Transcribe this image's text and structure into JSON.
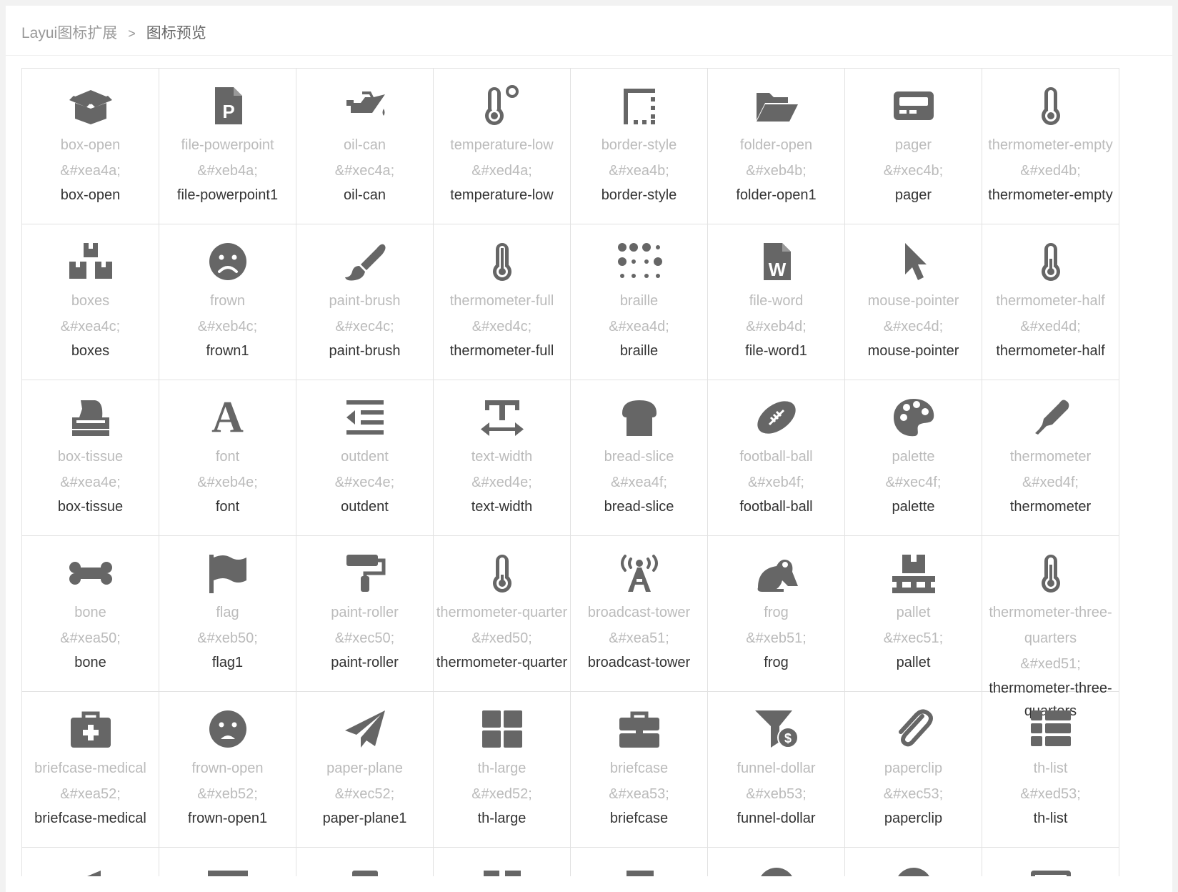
{
  "breadcrumb": {
    "home": "Layui图标扩展",
    "separator": ">",
    "current": "图标预览"
  },
  "icons": [
    {
      "icon": "box-open-icon",
      "cls": "box-open",
      "uni": "&#xea4a;",
      "name": "box-open"
    },
    {
      "icon": "file-powerpoint-icon",
      "cls": "file-powerpoint",
      "uni": "&#xeb4a;",
      "name": "file-powerpoint1"
    },
    {
      "icon": "oil-can-icon",
      "cls": "oil-can",
      "uni": "&#xec4a;",
      "name": "oil-can"
    },
    {
      "icon": "temperature-low-icon",
      "cls": "temperature-low",
      "uni": "&#xed4a;",
      "name": "temperature-low"
    },
    {
      "icon": "border-style-icon",
      "cls": "border-style",
      "uni": "&#xea4b;",
      "name": "border-style"
    },
    {
      "icon": "folder-open-icon",
      "cls": "folder-open",
      "uni": "&#xeb4b;",
      "name": "folder-open1"
    },
    {
      "icon": "pager-icon",
      "cls": "pager",
      "uni": "&#xec4b;",
      "name": "pager"
    },
    {
      "icon": "thermometer-empty-icon",
      "cls": "thermometer-empty",
      "uni": "&#xed4b;",
      "name": "thermometer-empty"
    },
    {
      "icon": "boxes-icon",
      "cls": "boxes",
      "uni": "&#xea4c;",
      "name": "boxes"
    },
    {
      "icon": "frown-icon",
      "cls": "frown",
      "uni": "&#xeb4c;",
      "name": "frown1"
    },
    {
      "icon": "paint-brush-icon",
      "cls": "paint-brush",
      "uni": "&#xec4c;",
      "name": "paint-brush"
    },
    {
      "icon": "thermometer-full-icon",
      "cls": "thermometer-full",
      "uni": "&#xed4c;",
      "name": "thermometer-full"
    },
    {
      "icon": "braille-icon",
      "cls": "braille",
      "uni": "&#xea4d;",
      "name": "braille"
    },
    {
      "icon": "file-word-icon",
      "cls": "file-word",
      "uni": "&#xeb4d;",
      "name": "file-word1"
    },
    {
      "icon": "mouse-pointer-icon",
      "cls": "mouse-pointer",
      "uni": "&#xec4d;",
      "name": "mouse-pointer"
    },
    {
      "icon": "thermometer-half-icon",
      "cls": "thermometer-half",
      "uni": "&#xed4d;",
      "name": "thermometer-half"
    },
    {
      "icon": "box-tissue-icon",
      "cls": "box-tissue",
      "uni": "&#xea4e;",
      "name": "box-tissue"
    },
    {
      "icon": "font-icon",
      "cls": "font",
      "uni": "&#xeb4e;",
      "name": "font",
      "glyph": "A"
    },
    {
      "icon": "outdent-icon",
      "cls": "outdent",
      "uni": "&#xec4e;",
      "name": "outdent"
    },
    {
      "icon": "text-width-icon",
      "cls": "text-width",
      "uni": "&#xed4e;",
      "name": "text-width"
    },
    {
      "icon": "bread-slice-icon",
      "cls": "bread-slice",
      "uni": "&#xea4f;",
      "name": "bread-slice"
    },
    {
      "icon": "football-ball-icon",
      "cls": "football-ball",
      "uni": "&#xeb4f;",
      "name": "football-ball"
    },
    {
      "icon": "palette-icon",
      "cls": "palette",
      "uni": "&#xec4f;",
      "name": "palette"
    },
    {
      "icon": "thermometer-icon",
      "cls": "thermometer",
      "uni": "&#xed4f;",
      "name": "thermometer"
    },
    {
      "icon": "bone-icon",
      "cls": "bone",
      "uni": "&#xea50;",
      "name": "bone"
    },
    {
      "icon": "flag-icon",
      "cls": "flag",
      "uni": "&#xeb50;",
      "name": "flag1"
    },
    {
      "icon": "paint-roller-icon",
      "cls": "paint-roller",
      "uni": "&#xec50;",
      "name": "paint-roller"
    },
    {
      "icon": "thermometer-quarter-icon",
      "cls": "thermometer-quarter",
      "uni": "&#xed50;",
      "name": "thermometer-quarter"
    },
    {
      "icon": "broadcast-tower-icon",
      "cls": "broadcast-tower",
      "uni": "&#xea51;",
      "name": "broadcast-tower"
    },
    {
      "icon": "frog-icon",
      "cls": "frog",
      "uni": "&#xeb51;",
      "name": "frog"
    },
    {
      "icon": "pallet-icon",
      "cls": "pallet",
      "uni": "&#xec51;",
      "name": "pallet"
    },
    {
      "icon": "thermometer-three-quarters-icon",
      "cls": "thermometer-three-quarters",
      "uni": "&#xed51;",
      "name": "thermometer-three-quarters"
    },
    {
      "icon": "briefcase-medical-icon",
      "cls": "briefcase-medical",
      "uni": "&#xea52;",
      "name": "briefcase-medical"
    },
    {
      "icon": "frown-open-icon",
      "cls": "frown-open",
      "uni": "&#xeb52;",
      "name": "frown-open1"
    },
    {
      "icon": "paper-plane-icon",
      "cls": "paper-plane",
      "uni": "&#xec52;",
      "name": "paper-plane1"
    },
    {
      "icon": "th-large-icon",
      "cls": "th-large",
      "uni": "&#xed52;",
      "name": "th-large"
    },
    {
      "icon": "briefcase-icon",
      "cls": "briefcase",
      "uni": "&#xea53;",
      "name": "briefcase"
    },
    {
      "icon": "funnel-dollar-icon",
      "cls": "funnel-dollar",
      "uni": "&#xeb53;",
      "name": "funnel-dollar"
    },
    {
      "icon": "paperclip-icon",
      "cls": "paperclip",
      "uni": "&#xec53;",
      "name": "paperclip"
    },
    {
      "icon": "th-list-icon",
      "cls": "th-list",
      "uni": "&#xed53;",
      "name": "th-list"
    }
  ],
  "partial_row_icons": [
    "bullhorn-icon",
    "archway-icon",
    "paint-brush-alt-icon",
    "book-open-icon",
    "book-icon",
    "grin-icon",
    "basketball-icon",
    "tv-icon"
  ],
  "colors": {
    "icon": "#666666",
    "muted_text": "#bbbbbb",
    "name_text": "#333333",
    "grid_border": "#e2e2e2"
  }
}
